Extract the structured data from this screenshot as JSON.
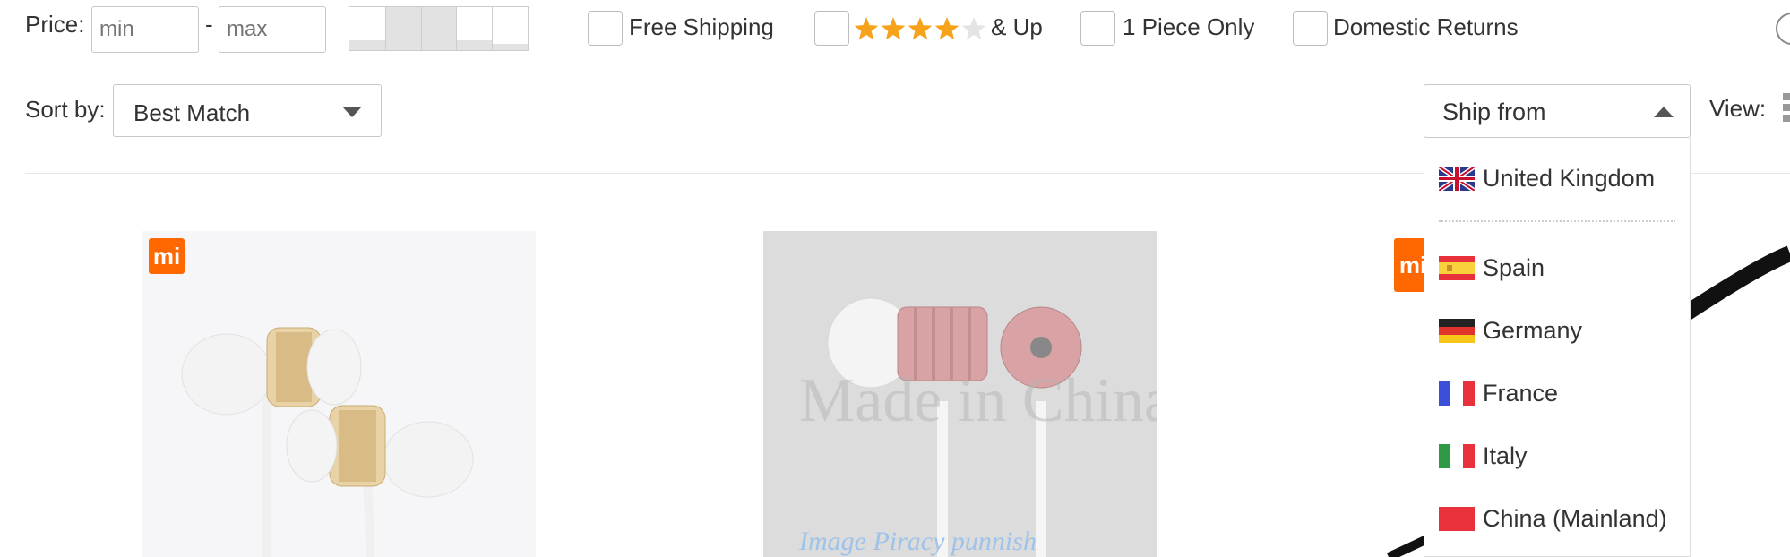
{
  "filters": {
    "price_label": "Price:",
    "min_placeholder": "min",
    "dash": "-",
    "max_placeholder": "max",
    "price_histogram": [
      0.22,
      1.0,
      1.0,
      0.22,
      0.14
    ],
    "free_shipping": "Free Shipping",
    "rating_suffix": "& Up",
    "rating_stars": 4,
    "one_piece": "1 Piece Only",
    "domestic_returns": "Domestic Returns"
  },
  "sort": {
    "label": "Sort by:",
    "value": "Best Match"
  },
  "ship_from": {
    "label": "Ship from",
    "options": [
      "United Kingdom",
      "Spain",
      "Germany",
      "France",
      "Italy",
      "China (Mainland)"
    ]
  },
  "view": {
    "label": "View:"
  },
  "products": [
    {
      "brand_logo": "mi"
    },
    {
      "watermark": "Made in China",
      "watermark_bottom": "Image Piracy punnish"
    },
    {
      "brand_logo": "mi"
    }
  ],
  "colors": {
    "star": "#f7a21b",
    "mi_orange": "#ff6700",
    "rose_gold": "#d9a3a5"
  }
}
